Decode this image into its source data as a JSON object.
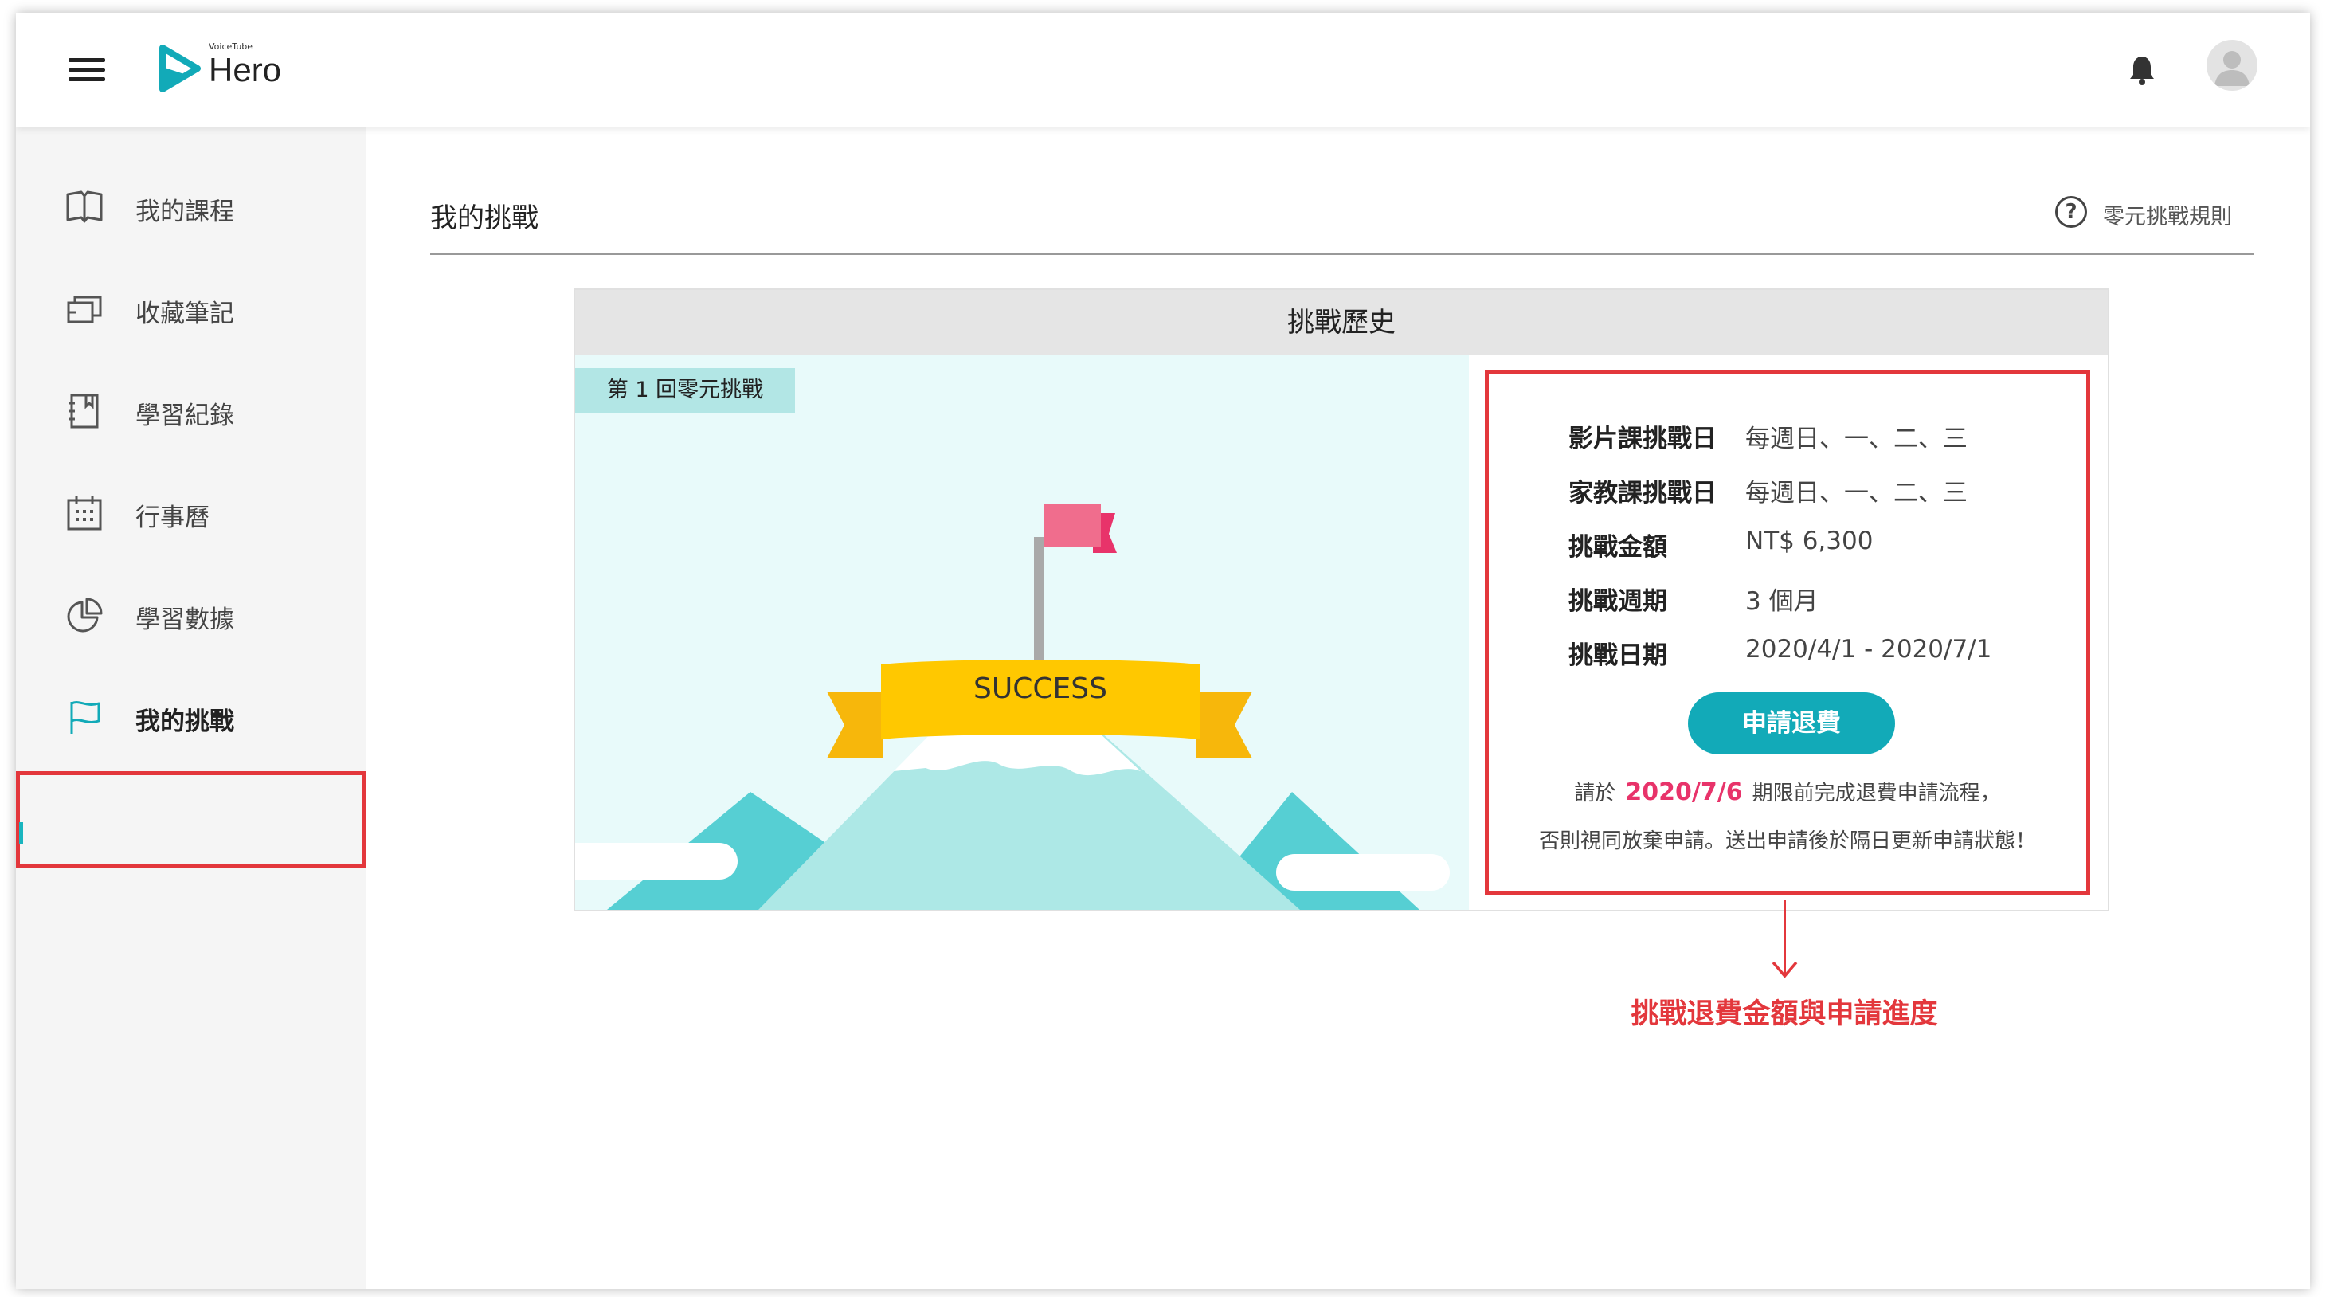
{
  "header": {
    "logo_small": "VoiceTube",
    "logo_text": "Hero"
  },
  "sidebar": {
    "items": [
      {
        "label": "我的課程",
        "icon": "book-icon"
      },
      {
        "label": "收藏筆記",
        "icon": "cards-icon"
      },
      {
        "label": "學習紀錄",
        "icon": "notebook-icon"
      },
      {
        "label": "行事曆",
        "icon": "calendar-icon"
      },
      {
        "label": "學習數據",
        "icon": "pie-chart-icon"
      },
      {
        "label": "我的挑戰",
        "icon": "flag-icon",
        "active": true
      }
    ]
  },
  "main": {
    "title": "我的挑戰",
    "rules_link": "零元挑戰規則",
    "history": {
      "heading": "挑戰歷史",
      "round_tag": "第 1 回零元挑戰",
      "banner_text": "SUCCESS",
      "details": [
        {
          "key": "影片課挑戰日",
          "value": "每週日、一、二、三"
        },
        {
          "key": "家教課挑戰日",
          "value": "每週日、一、二、三"
        },
        {
          "key": "挑戰金額",
          "value": "NT$ 6,300"
        },
        {
          "key": "挑戰週期",
          "value": "3 個月"
        },
        {
          "key": "挑戰日期",
          "value": "2020/4/1 - 2020/7/1"
        }
      ],
      "refund_button": "申請退費",
      "notice_prefix": "請於",
      "notice_date": "2020/7/6",
      "notice_suffix": "期限前完成退費申請流程，",
      "notice_line2": "否則視同放棄申請。送出申請後於隔日更新申請狀態！"
    }
  },
  "annotation": "挑戰退費金額與申請進度",
  "colors": {
    "accent": "#12aab8",
    "highlight_red": "#e3373c",
    "date_pink": "#e8336a",
    "banner_yellow": "#ffc800"
  }
}
